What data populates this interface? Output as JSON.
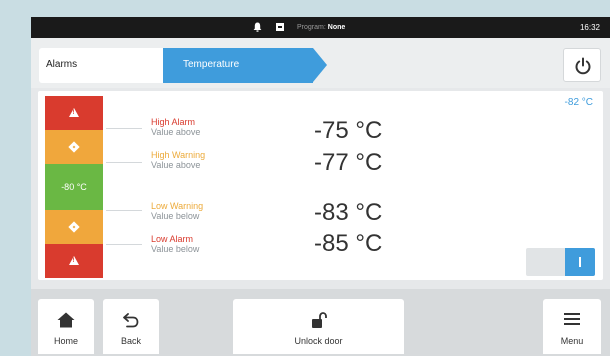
{
  "status_bar": {
    "program_label": "Program:",
    "program_value": "None",
    "time": "16:32",
    "icons": [
      "bell-icon",
      "device-icon"
    ]
  },
  "breadcrumb": {
    "items": [
      {
        "label": "Alarms"
      },
      {
        "label": "Temperature"
      }
    ],
    "power_icon": "power-icon"
  },
  "alarm_scale": {
    "current_setpoint": "-80 °C",
    "segments": [
      {
        "kind": "high-alarm",
        "color": "#d93b2e",
        "icon": "warning-triangle-icon"
      },
      {
        "kind": "high-warning",
        "color": "#f0a73c",
        "icon": "warning-diamond-icon"
      },
      {
        "kind": "normal",
        "color": "#6ab844"
      },
      {
        "kind": "low-warning",
        "color": "#f0a73c",
        "icon": "warning-diamond-icon"
      },
      {
        "kind": "low-alarm",
        "color": "#d93b2e",
        "icon": "warning-triangle-icon"
      }
    ]
  },
  "thresholds": [
    {
      "title": "High Alarm",
      "subtitle": "Value above",
      "value": "-75 °C",
      "color": "#d93b2e"
    },
    {
      "title": "High Warning",
      "subtitle": "Value above",
      "value": "-77 °C",
      "color": "#ecaa3a"
    },
    {
      "title": "Low Warning",
      "subtitle": "Value below",
      "value": "-83 °C",
      "color": "#ecaa3a"
    },
    {
      "title": "Low Alarm",
      "subtitle": "Value below",
      "value": "-85 °C",
      "color": "#d93b2e"
    }
  ],
  "current_temperature": "-82 °C",
  "toggle": {
    "state": "on"
  },
  "bottom_nav": {
    "home": "Home",
    "back": "Back",
    "unlock": "Unlock door",
    "menu": "Menu"
  },
  "colors": {
    "accent": "#3f9cdc",
    "alarm": "#d93b2e",
    "warning": "#f0a73c",
    "ok": "#6ab844"
  }
}
